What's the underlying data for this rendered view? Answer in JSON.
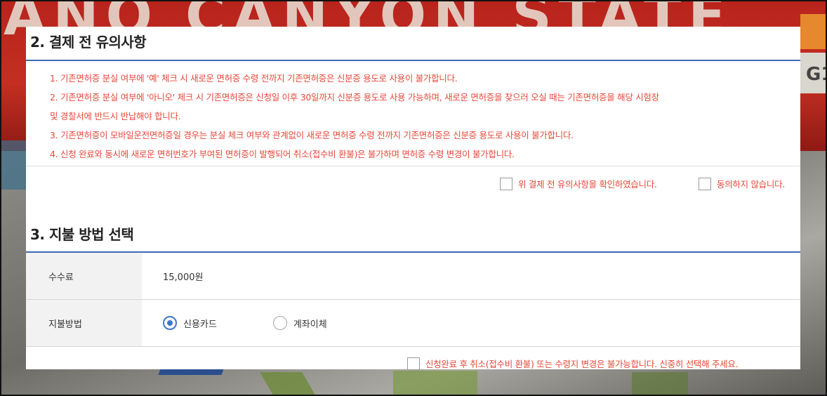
{
  "background": {
    "plate_text": "ANO CANYON STATE",
    "plate_right_text": "G1"
  },
  "section2": {
    "title": "2. 결제 전 유의사항",
    "notices": [
      "1. 기존면허증 분실 여부에 '예' 체크 시 새로운 면허증 수령 전까지 기존면허증은 신분증 용도로 사용이 불가합니다.",
      "2. 기존면허증 분실 여부에 '아니오' 체크 시 기존면허증은 신청일 이후 30일까지 신분증 용도로 사용 가능하며, 새로운 면허증을 찾으러 오실 때는 기존면허증을 해당 시험장",
      "및 경찰서에 반드시 반납해야 합니다.",
      "3. 기존면허증이 모바일운전면허증일 경우는 분실 체크 여부와 관계없이 새로운 면허증 수령 전까지 기존면허증은 신분증 용도로 사용이 불가합니다.",
      "4. 신청 완료와 동시에 새로운 면허번호가 부여된 면허증이 발행되어 취소(접수비 환불)은 불가하며 면허증 수령 변경이 불가합니다."
    ],
    "agree_label": "위 결제 전 유의사항을 확인하였습니다.",
    "disagree_label": "동의하지 않습니다."
  },
  "section3": {
    "title": "3. 지불 방법 선택",
    "fee_label": "수수료",
    "fee_value": "15,000원",
    "method_label": "지불방법",
    "methods": [
      {
        "label": "신용카드",
        "selected": true
      },
      {
        "label": "계좌이체",
        "selected": false
      }
    ],
    "final_notice": "신청완료 후 취소(접수비 환불) 또는 수령지 변경은 불가능합니다. 신중히 선택해 주세요."
  },
  "colors": {
    "accent": "#3f6ab5",
    "warning": "#e5493b",
    "radio_selected": "#3f77c8"
  }
}
